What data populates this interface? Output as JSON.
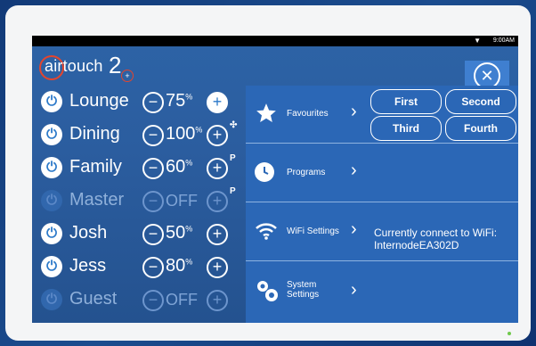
{
  "status_bar": {
    "time": "9:00AM"
  },
  "header": {
    "logo_word": "airtouch",
    "logo_number": "2",
    "logo_plus": "+"
  },
  "zones": [
    {
      "name": "Lounge",
      "value": "75",
      "unit": "%",
      "state": "on",
      "badge": ""
    },
    {
      "name": "Dining",
      "value": "100",
      "unit": "%",
      "state": "on",
      "badge": "fan"
    },
    {
      "name": "Family",
      "value": "60",
      "unit": "%",
      "state": "on",
      "badge": "P"
    },
    {
      "name": "Master",
      "value": "OFF",
      "unit": "",
      "state": "off",
      "badge": "P"
    },
    {
      "name": "Josh",
      "value": "50",
      "unit": "%",
      "state": "on",
      "badge": ""
    },
    {
      "name": "Jess",
      "value": "80",
      "unit": "%",
      "state": "on",
      "badge": ""
    },
    {
      "name": "Guest",
      "value": "OFF",
      "unit": "",
      "state": "off",
      "badge": ""
    }
  ],
  "panel": {
    "favourites": {
      "label": "Favourites",
      "buttons": [
        "First",
        "Second",
        "Third",
        "Fourth"
      ]
    },
    "programs": {
      "label": "Programs"
    },
    "wifi": {
      "label": "WiFi Settings",
      "status_line1": "Currently connect to WiFi:",
      "status_line2": "InternodeEA302D"
    },
    "system": {
      "label_line1": "System",
      "label_line2": "Settings"
    }
  },
  "colors": {
    "accent": "#2b79c9",
    "logo_red": "#e3452e",
    "panel": "#2b67b6"
  }
}
